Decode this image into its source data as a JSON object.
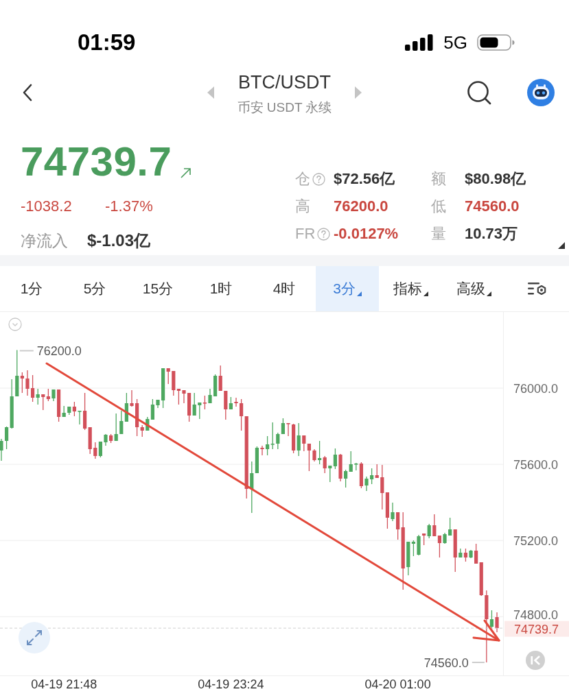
{
  "status_bar": {
    "time": "01:59",
    "network": "5G"
  },
  "header": {
    "title": "BTC/USDT",
    "subtitle": "币安 USDT 永续"
  },
  "ticker": {
    "price": "74739.7",
    "trend_up": true,
    "change": "-1038.2",
    "change_percent": "-1.37%",
    "net_inflow_label": "净流入",
    "net_inflow_value": "$-1.03亿"
  },
  "stats": [
    {
      "label": "仓",
      "info": true,
      "value": "$72.56亿",
      "color": "#333333"
    },
    {
      "label": "额",
      "info": false,
      "value": "$80.98亿",
      "color": "#333333"
    },
    {
      "label": "高",
      "info": false,
      "value": "76200.0",
      "color": "#c9473f"
    },
    {
      "label": "低",
      "info": false,
      "value": "74560.0",
      "color": "#c9473f"
    },
    {
      "label": "FR",
      "info": true,
      "value": "-0.0127%",
      "color": "#c9473f"
    },
    {
      "label": "量",
      "info": false,
      "value": "10.73万",
      "color": "#333333"
    }
  ],
  "intervals": [
    {
      "label": "1分",
      "selected": false,
      "menu": false
    },
    {
      "label": "5分",
      "selected": false,
      "menu": false
    },
    {
      "label": "15分",
      "selected": false,
      "menu": false
    },
    {
      "label": "1时",
      "selected": false,
      "menu": false
    },
    {
      "label": "4时",
      "selected": false,
      "menu": false
    },
    {
      "label": "3分",
      "selected": true,
      "menu": true
    },
    {
      "label": "指标",
      "selected": false,
      "menu": true
    },
    {
      "label": "高级",
      "selected": false,
      "menu": true
    }
  ],
  "chart": {
    "last_price": "74739.7",
    "high_label": "76200.0",
    "low_label": "74560.0",
    "chart_data": {
      "type": "candlestick",
      "categories": [
        null,
        null,
        null,
        null,
        null,
        null,
        null,
        null,
        null,
        null,
        null,
        null,
        "04-19 21:48",
        null,
        null,
        null,
        null,
        null,
        null,
        null,
        null,
        null,
        null,
        null,
        null,
        null,
        null,
        null,
        null,
        null,
        null,
        null,
        null,
        null,
        null,
        null,
        null,
        null,
        null,
        null,
        null,
        null,
        null,
        null,
        "04-19 23:24",
        null,
        null,
        null,
        null,
        null,
        null,
        null,
        null,
        null,
        null,
        null,
        null,
        null,
        null,
        null,
        null,
        null,
        null,
        null,
        null,
        null,
        null,
        null,
        null,
        null,
        null,
        null,
        null,
        null,
        null,
        null,
        "04-20 01:00",
        null,
        null,
        null,
        null,
        null,
        null,
        null,
        null,
        null,
        null,
        null,
        null,
        null,
        null,
        null,
        null,
        null,
        null,
        null
      ],
      "ohlc": [
        [
          75672.4,
          75733.6,
          75618.4,
          75722.8
        ],
        [
          75722.8,
          75798.4,
          75679.6,
          75794.8
        ],
        [
          75791.2,
          76046.8,
          75787.6,
          75956.8
        ],
        [
          75956.8,
          76200.0,
          75956.8,
          76064.8
        ],
        [
          76064.8,
          76082.8,
          75974.8,
          76050.4
        ],
        [
          76050.4,
          76093.6,
          75960.4,
          75996.4
        ],
        [
          76000.0,
          76068.4,
          75928.0,
          75949.6
        ],
        [
          75949.6,
          75996.4,
          75913.6,
          75967.6
        ],
        [
          75967.6,
          75967.6,
          75884.8,
          75953.2
        ],
        [
          75956.8,
          75996.4,
          75931.6,
          75942.4
        ],
        [
          75946.0,
          75992.8,
          75931.6,
          75992.8
        ],
        [
          75992.8,
          75992.8,
          75823.6,
          75848.8
        ],
        [
          75848.8,
          75906.4,
          75848.8,
          75870.4
        ],
        [
          75870.4,
          75902.8,
          75859.6,
          75902.8
        ],
        [
          75902.8,
          75928.0,
          75852.4,
          75877.6
        ],
        [
          75877.6,
          75881.2,
          75809.2,
          75881.2
        ],
        [
          75881.2,
          75974.8,
          75780.4,
          75787.6
        ],
        [
          75794.8,
          75794.8,
          75654.4,
          75679.6
        ],
        [
          75686.8,
          75715.6,
          75629.2,
          75643.6
        ],
        [
          75643.6,
          75719.2,
          75636.4,
          75719.2
        ],
        [
          75715.6,
          75758.8,
          75697.6,
          75755.2
        ],
        [
          75751.6,
          75758.8,
          75712.0,
          75722.8
        ],
        [
          75722.8,
          75866.8,
          75722.8,
          75758.8
        ],
        [
          75758.8,
          75881.2,
          75758.8,
          75827.2
        ],
        [
          75823.6,
          75974.8,
          75823.6,
          75920.8
        ],
        [
          75920.8,
          75989.2,
          75902.8,
          75906.4
        ],
        [
          75920.8,
          75942.4,
          75748.0,
          75794.8
        ],
        [
          75794.8,
          75805.6,
          75744.4,
          75776.8
        ],
        [
          75776.8,
          75848.8,
          75776.8,
          75838.0
        ],
        [
          75834.4,
          75942.4,
          75834.4,
          75913.6
        ],
        [
          75910.0,
          75938.8,
          75895.6,
          75938.8
        ],
        [
          75935.2,
          76104.4,
          75895.6,
          76104.4
        ],
        [
          76104.4,
          76104.4,
          76021.6,
          76086.4
        ],
        [
          76090.0,
          76090.0,
          75960.4,
          75989.2
        ],
        [
          75996.4,
          75996.4,
          75913.6,
          75985.6
        ],
        [
          75989.2,
          75989.2,
          75920.8,
          75971.2
        ],
        [
          75974.8,
          75974.8,
          75823.6,
          75856.0
        ],
        [
          75856.0,
          75974.8,
          75856.0,
          75913.6
        ],
        [
          75910.0,
          75924.4,
          75838.0,
          75924.4
        ],
        [
          75924.4,
          75960.4,
          75888.4,
          75920.8
        ],
        [
          75920.8,
          75996.4,
          75920.8,
          75964.0
        ],
        [
          75956.8,
          76072.0,
          75956.8,
          76064.8
        ],
        [
          76064.8,
          76118.8,
          75985.6,
          75985.6
        ],
        [
          75985.6,
          75985.6,
          75834.4,
          75888.4
        ],
        [
          75888.4,
          75953.2,
          75888.4,
          75920.8
        ],
        [
          75928.0,
          75949.6,
          75902.8,
          75920.8
        ],
        [
          75920.8,
          75942.4,
          75776.8,
          75852.4
        ],
        [
          75852.4,
          75852.4,
          75420.4,
          75470.8
        ],
        [
          75470.8,
          75614.8,
          75344.8,
          75553.6
        ],
        [
          75553.6,
          75694.0,
          75553.6,
          75686.8
        ],
        [
          75686.8,
          75697.6,
          75647.2,
          75679.6
        ],
        [
          75679.6,
          75748.0,
          75647.2,
          75704.8
        ],
        [
          75704.8,
          75820.0,
          75679.6,
          75708.4
        ],
        [
          75708.4,
          75766.0,
          75679.6,
          75758.8
        ],
        [
          75758.8,
          75841.6,
          75758.8,
          75816.4
        ],
        [
          75816.4,
          75816.4,
          75748.0,
          75812.8
        ],
        [
          75809.2,
          75812.8,
          75658.0,
          75672.4
        ],
        [
          75672.4,
          75816.4,
          75643.6,
          75751.6
        ],
        [
          75751.6,
          75751.6,
          75668.8,
          75708.4
        ],
        [
          75708.4,
          75708.4,
          75564.4,
          75672.4
        ],
        [
          75672.4,
          75679.6,
          75614.8,
          75622.0
        ],
        [
          75622.0,
          75722.8,
          75600.4,
          75632.8
        ],
        [
          75636.4,
          75643.6,
          75553.6,
          75578.8
        ],
        [
          75578.8,
          75593.2,
          75506.8,
          75593.2
        ],
        [
          75589.6,
          75683.2,
          75575.2,
          75650.8
        ],
        [
          75650.8,
          75654.4,
          75510.4,
          75524.8
        ],
        [
          75524.8,
          75571.6,
          75478.0,
          75564.4
        ],
        [
          75560.8,
          75668.8,
          75560.8,
          75600.4
        ],
        [
          75600.4,
          75607.6,
          75568.0,
          75604.0
        ],
        [
          75604.0,
          75611.2,
          75474.4,
          75485.2
        ],
        [
          75488.8,
          75535.6,
          75460.0,
          75524.8
        ],
        [
          75521.2,
          75578.8,
          75496.0,
          75542.8
        ],
        [
          75542.8,
          75600.4,
          75528.4,
          75528.4
        ],
        [
          75532.0,
          75596.8,
          75362.8,
          75449.2
        ],
        [
          75452.8,
          75452.8,
          75262.0,
          75319.6
        ],
        [
          75312.4,
          75398.8,
          75301.6,
          75348.4
        ],
        [
          75348.4,
          75348.4,
          75204.4,
          75258.4
        ],
        [
          75269.2,
          75348.4,
          74941.6,
          75053.2
        ],
        [
          75060.4,
          75193.6,
          75017.2,
          75193.6
        ],
        [
          75182.8,
          75200.8,
          75118.0,
          75193.6
        ],
        [
          75125.2,
          75229.6,
          75121.6,
          75222.4
        ],
        [
          75236.8,
          75236.8,
          75175.6,
          75226.0
        ],
        [
          75222.4,
          75287.2,
          75211.6,
          75280.0
        ],
        [
          75280.0,
          75337.6,
          75222.4,
          75222.4
        ],
        [
          75226.0,
          75226.0,
          75110.8,
          75186.4
        ],
        [
          75186.4,
          75240.4,
          75182.8,
          75233.2
        ],
        [
          75226.0,
          75319.6,
          75226.0,
          75258.4
        ],
        [
          75258.4,
          75258.4,
          75035.2,
          75110.8
        ],
        [
          75110.8,
          75157.6,
          75110.8,
          75136.0
        ],
        [
          75136.0,
          75157.6,
          75089.2,
          75110.8
        ],
        [
          75110.8,
          75150.4,
          75107.2,
          75146.8
        ],
        [
          75146.8,
          75182.8,
          75078.4,
          75078.4
        ],
        [
          75085.6,
          75085.6,
          74909.2,
          74912.8
        ],
        [
          74912.8,
          74938.0,
          74560.0,
          74786.8
        ],
        [
          74747.2,
          74833.6,
          74740.0,
          74786.8
        ],
        [
          74797.6,
          74822.8,
          74718.4,
          74739.7
        ]
      ],
      "ylim": [
        74491.6,
        76399.6
      ],
      "grid": true,
      "yticks": [
        {
          "value": 76000,
          "label": "76000.0"
        },
        {
          "value": 75600,
          "label": "75600.0"
        },
        {
          "value": 75200,
          "label": "75200.0"
        },
        {
          "value": 74800,
          "label": "74800.0"
        }
      ]
    }
  }
}
